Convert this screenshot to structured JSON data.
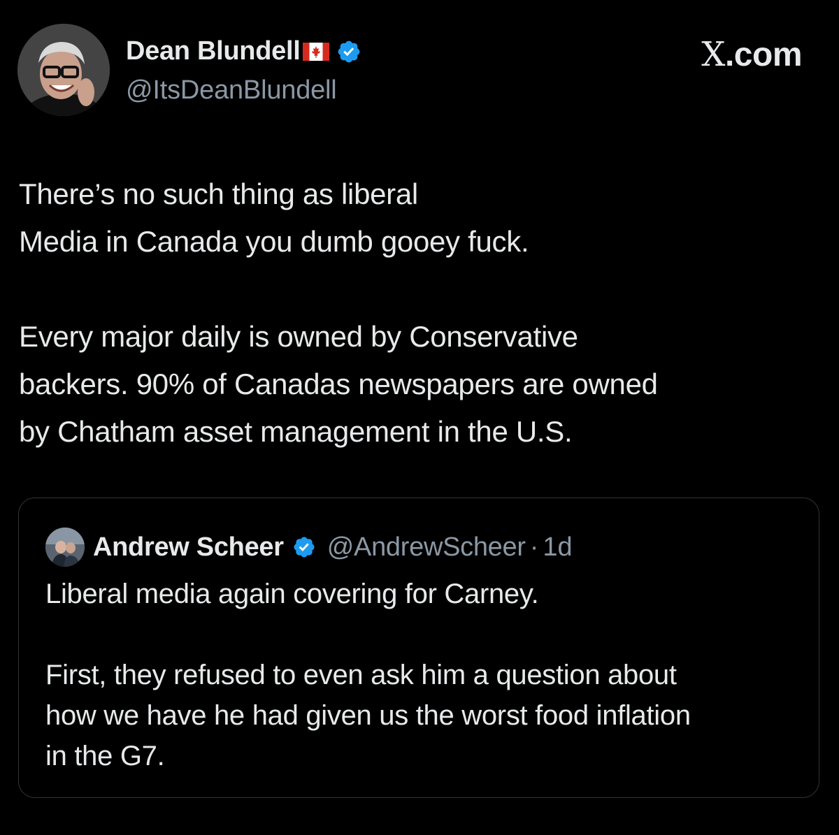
{
  "post": {
    "author_name": "Dean Blundell",
    "author_handle": "@ItsDeanBlundell",
    "author_flag_icon": "canada-flag-icon",
    "verified_icon": "verified-badge-icon",
    "brand": {
      "x": "X",
      "dotcom": ".com"
    },
    "text": "There’s no such thing as liberal\nMedia in Canada you dumb gooey fuck.\n\nEvery major daily is owned by Conservative\nbackers. 90% of Canadas newspapers are owned\nby Chatham asset management in the U.S."
  },
  "quoted_post": {
    "author_name": "Andrew Scheer",
    "author_handle": "@AndrewScheer",
    "separator": "·",
    "time": "1d",
    "verified_icon": "verified-badge-icon",
    "text": "Liberal media again covering for Carney.\n\nFirst, they refused to even ask him a question about\nhow we have he had given us the worst food inflation\nin the G7."
  },
  "colors": {
    "background": "#000000",
    "text_primary": "#e7e9ea",
    "text_secondary": "#8b98a5",
    "verified_blue": "#1d9bf0",
    "quote_border": "#2f3336",
    "flag_red": "#d52b1e"
  }
}
